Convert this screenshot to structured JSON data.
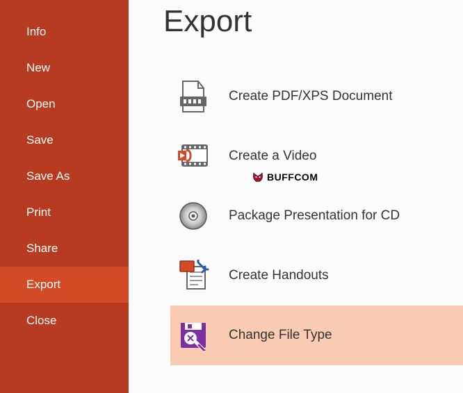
{
  "sidebar": {
    "items": [
      {
        "label": "Info"
      },
      {
        "label": "New"
      },
      {
        "label": "Open"
      },
      {
        "label": "Save"
      },
      {
        "label": "Save As"
      },
      {
        "label": "Print"
      },
      {
        "label": "Share"
      },
      {
        "label": "Export"
      },
      {
        "label": "Close"
      }
    ],
    "active_index": 7
  },
  "main": {
    "title": "Export",
    "options": [
      {
        "label": "Create PDF/XPS Document",
        "icon": "pdf-xps"
      },
      {
        "label": "Create a Video",
        "icon": "video"
      },
      {
        "label": "Package Presentation for CD",
        "icon": "cd"
      },
      {
        "label": "Create Handouts",
        "icon": "handouts"
      },
      {
        "label": "Change File Type",
        "icon": "change-file-type"
      }
    ],
    "selected_index": 4
  },
  "watermark": {
    "text": "BUFFCOM"
  }
}
